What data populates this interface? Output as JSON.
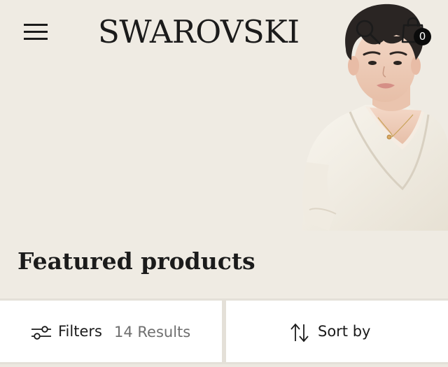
{
  "header": {
    "brand": "SWAROVSKI",
    "cart_count": "0",
    "icons": {
      "menu": "hamburger-menu-icon",
      "search": "magnifier-search-icon",
      "cart": "shopping-bag-icon"
    }
  },
  "hero": {
    "image": "portrait of a young man with dark hair in a white robe wearing a pendant necklace",
    "background_color": "#efebe3"
  },
  "page": {
    "title": "Featured products"
  },
  "toolbar": {
    "filters_label": "Filters",
    "results": "14 Results",
    "sort_label": "Sort by",
    "icons": {
      "filters": "sliders-filter-icon",
      "sort": "sort-arrows-icon"
    }
  },
  "colors": {
    "background": "#efebe3",
    "text": "#1b1b1b",
    "muted": "#6f6f6f",
    "badge": "#0b0b0b",
    "toolbar_bg": "#ffffff"
  }
}
